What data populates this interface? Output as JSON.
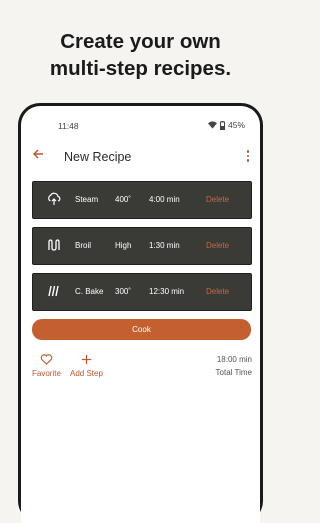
{
  "headline": {
    "line1": "Create your own",
    "line2": "multi-step recipes."
  },
  "status": {
    "time": "11:48",
    "battery": "45%"
  },
  "appbar": {
    "title": "New Recipe"
  },
  "steps": [
    {
      "icon": "steam-icon",
      "mode": "Steam",
      "temp": "400˚",
      "duration": "4:00 min",
      "delete": "Delete"
    },
    {
      "icon": "broil-icon",
      "mode": "Broil",
      "temp": "High",
      "duration": "1:30 min",
      "delete": "Delete"
    },
    {
      "icon": "convection-bake-icon",
      "mode": "C. Bake",
      "temp": "300˚",
      "duration": "12:30 min",
      "delete": "Delete"
    }
  ],
  "cook": {
    "label": "Cook"
  },
  "actions": {
    "favorite": "Favorite",
    "add_step": "Add Step"
  },
  "total": {
    "value": "18:00 min",
    "label": "Total Time"
  },
  "colors": {
    "accent": "#c4602f",
    "step_bg": "#3a3b37"
  }
}
